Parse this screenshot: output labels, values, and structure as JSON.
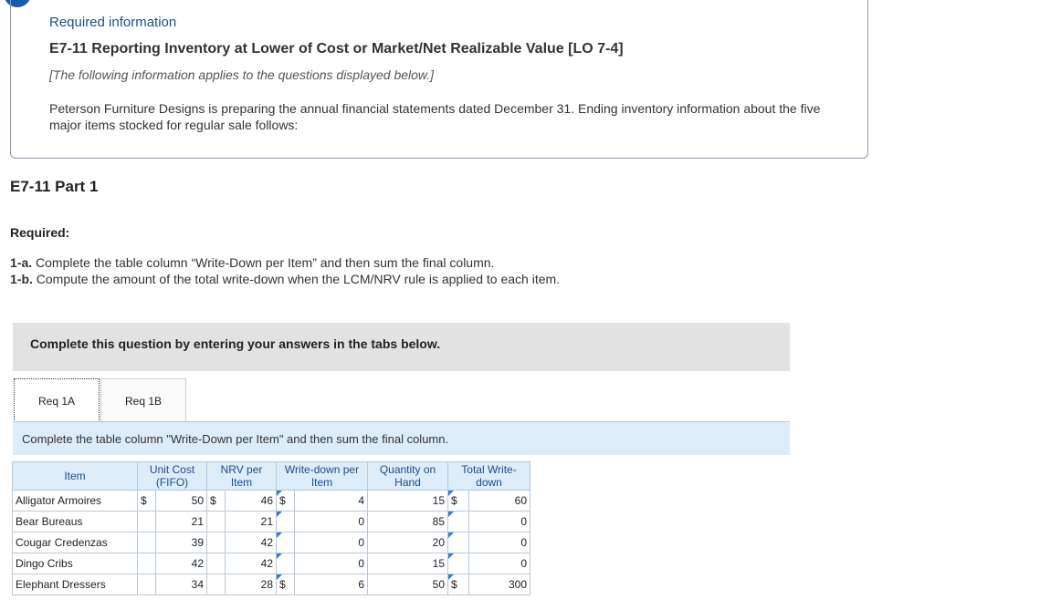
{
  "intro": {
    "required_info": "Required information",
    "exercise_title": "E7-11 Reporting Inventory at Lower of Cost or Market/Net Realizable Value [LO 7-4]",
    "note": "[The following information applies to the questions displayed below.]",
    "body": "Peterson Furniture Designs is preparing the annual financial statements dated December 31. Ending inventory information about the five major items stocked for regular sale follows:"
  },
  "part": {
    "title": "E7-11 Part 1",
    "required_label": "Required:",
    "requirements": [
      {
        "prefix": "1-a.",
        "text": " Complete the table column “Write-Down per Item” and then sum the final column."
      },
      {
        "prefix": "1-b.",
        "text": " Compute the amount of the total write-down when the LCM/NRV rule is applied to each item."
      }
    ]
  },
  "banner": "Complete this question by entering your answers in the tabs below.",
  "tabs": [
    {
      "label": "Req 1A",
      "active": true
    },
    {
      "label": "Req 1B",
      "active": false
    }
  ],
  "tab_instruction": "Complete the table column \"Write-Down per Item\" and then sum the final column.",
  "table": {
    "headers": {
      "item": "Item",
      "unit_cost": "Unit Cost (FIFO)",
      "nrv": "NRV per Item",
      "writedown": "Write-down per Item",
      "quantity": "Quantity on Hand",
      "total": "Total Write-down"
    },
    "currency": "$",
    "rows": [
      {
        "item": "Alligator Armoires",
        "cost": "50",
        "nrv": "46",
        "writedown": "4",
        "qty": "15",
        "total": "60"
      },
      {
        "item": "Bear Bureaus",
        "cost": "21",
        "nrv": "21",
        "writedown": "0",
        "qty": "85",
        "total": "0"
      },
      {
        "item": "Cougar Credenzas",
        "cost": "39",
        "nrv": "42",
        "writedown": "0",
        "qty": "20",
        "total": "0"
      },
      {
        "item": "Dingo Cribs",
        "cost": "42",
        "nrv": "42",
        "writedown": "0",
        "qty": "15",
        "total": "0"
      },
      {
        "item": "Elephant Dressers",
        "cost": "34",
        "nrv": "28",
        "writedown": "6",
        "qty": "50",
        "total": "300"
      }
    ]
  }
}
